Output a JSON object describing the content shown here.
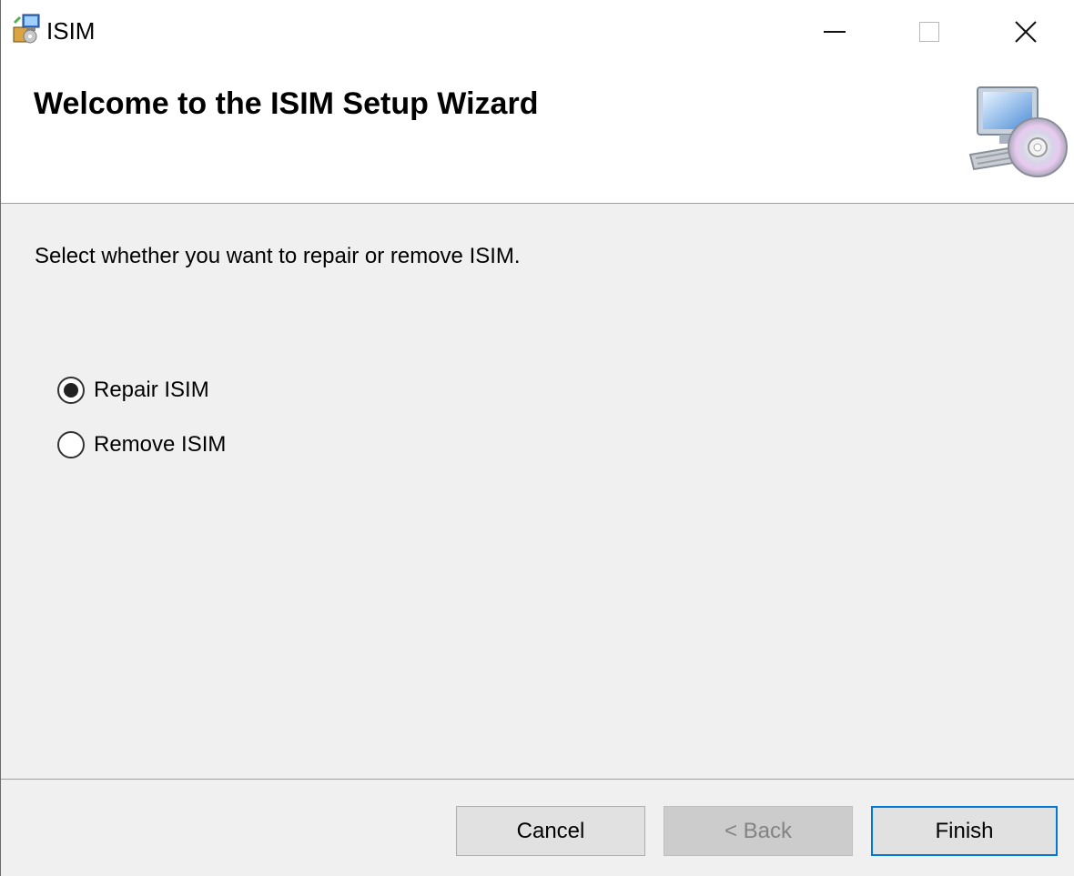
{
  "window": {
    "title": "ISIM",
    "icons": {
      "app": "installer-package-icon",
      "minimize": "minimize-icon",
      "maximize": "maximize-icon",
      "close": "close-icon"
    }
  },
  "header": {
    "title": "Welcome to the ISIM Setup Wizard",
    "icon": "computer-cd-icon"
  },
  "body": {
    "prompt": "Select whether you want to repair or remove ISIM.",
    "options": [
      {
        "label": "Repair ISIM",
        "selected": true
      },
      {
        "label": "Remove ISIM",
        "selected": false
      }
    ]
  },
  "footer": {
    "cancel_label": "Cancel",
    "back_label": "< Back",
    "finish_label": "Finish"
  },
  "colors": {
    "body_background": "#f0f0f0",
    "header_background": "#ffffff",
    "focus_border": "#0078d7",
    "disabled_text": "#838383"
  }
}
